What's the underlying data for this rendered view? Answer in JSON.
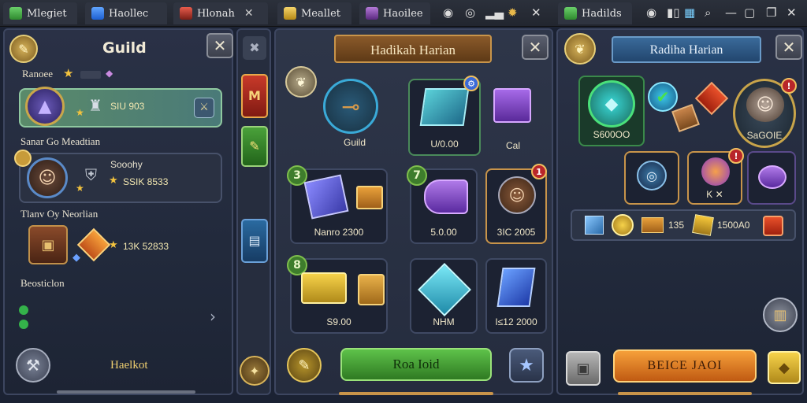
{
  "tabs": [
    {
      "label": "Mlegiet",
      "color": "#4caf50"
    },
    {
      "label": "Haollec",
      "color": "#3b82f6"
    },
    {
      "label": "Hlonah",
      "color": "#c0392b"
    },
    {
      "label": "Meallet",
      "color": "#e2b33b"
    },
    {
      "label": "Haoilee",
      "color": "#8e44ad"
    },
    {
      "label": "Hadilds",
      "color": "#4caf50"
    }
  ],
  "guild_panel": {
    "title": "Guild",
    "rank_label": "Ranoee",
    "entries": [
      {
        "stats": "SIU 903"
      },
      {
        "name": "Sanar Go Meadtian",
        "level": "Sooohy",
        "stats": "SSIK 8533"
      },
      {
        "name": "Tlanv Oy Neorlian",
        "stats": "13K 52833"
      },
      {
        "name": "Beosticlon"
      }
    ],
    "footer_label": "Haelkot"
  },
  "side_tabs": [
    "M",
    "✎",
    "▤"
  ],
  "daily_panel": {
    "title": "Hadikah Harian",
    "items": [
      {
        "label": "Guild"
      },
      {
        "label": "U/0.00"
      },
      {
        "label": "Cal"
      },
      {
        "label": "Nanro 2300",
        "badge": "3"
      },
      {
        "label": "5.0.00",
        "badge": "7"
      },
      {
        "label": "3IC 2005",
        "badge": "1"
      },
      {
        "label": "S9.00",
        "badge": "8"
      },
      {
        "label": "NHM"
      },
      {
        "label": "I≤12 2000"
      }
    ],
    "claim_button": "Roa Ioid"
  },
  "reward_panel": {
    "title": "Radiha Harian",
    "top_labels": [
      "S600OO",
      "SaGOIE"
    ],
    "mid_labels": [
      "K ✕"
    ],
    "bottom_values": [
      "135",
      "1500A0"
    ],
    "action_button": "BEICE JAOI"
  },
  "colors": {
    "green_button": "#4aa13a",
    "orange_button": "#e8892a",
    "panel_bg": "#232b3e"
  }
}
